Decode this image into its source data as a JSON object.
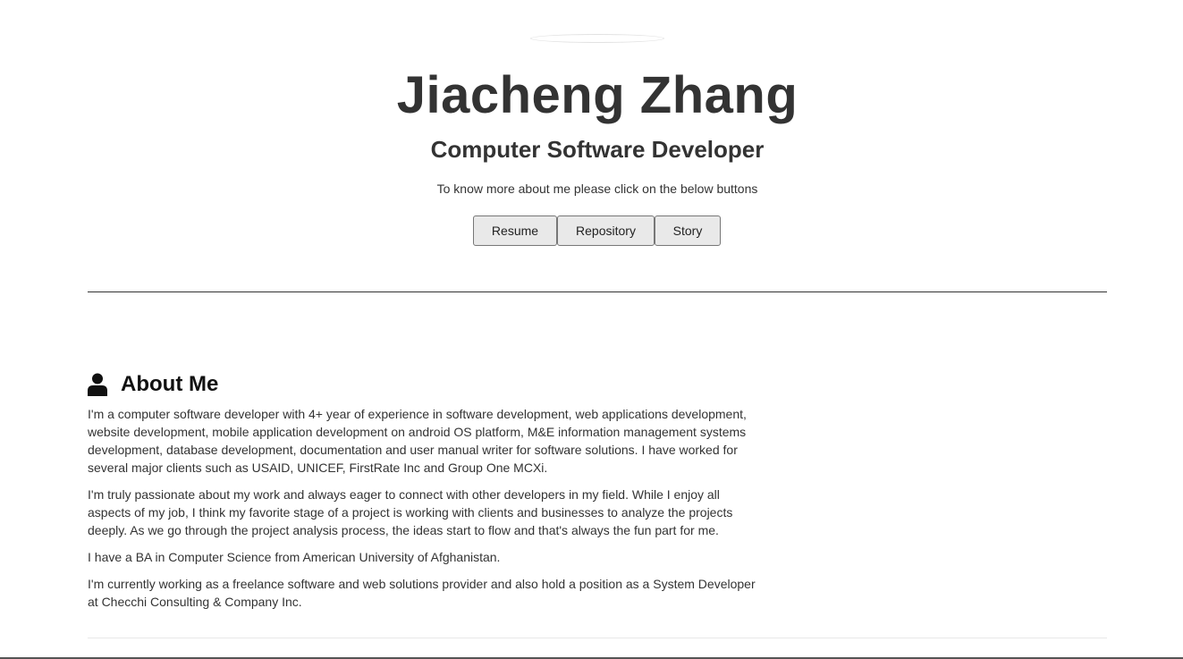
{
  "header": {
    "name": "Jiacheng Zhang",
    "role": "Computer Software Developer",
    "intro": "To know more about me please click on the below buttons"
  },
  "buttons": {
    "resume": "Resume",
    "repository": "Repository",
    "story": "Story"
  },
  "about": {
    "title": "About Me",
    "icon": "user-icon",
    "paragraphs": [
      "I'm a computer software developer with 4+ year of experience in software development, web applications development, website development, mobile application development on android OS platform, M&E information management systems development, database development, documentation and user manual writer for software solutions. I have worked for several major clients such as USAID, UNICEF, FirstRate Inc and Group One MCXi.",
      "I'm truly passionate about my work and always eager to connect with other developers in my field. While I enjoy all aspects of my job, I think my favorite stage of a project is working with clients and businesses to analyze the projects deeply. As we go through the project analysis process, the ideas start to flow and that's always the fun part for me.",
      "I have a BA in Computer Science from American University of Afghanistan.",
      "I'm currently working as a freelance software and web solutions provider and also hold a position as a System Developer at Checchi Consulting & Company Inc."
    ]
  },
  "colors": {
    "text": "#333333",
    "button_bg": "#e9e9e9",
    "divider": "#333333"
  }
}
